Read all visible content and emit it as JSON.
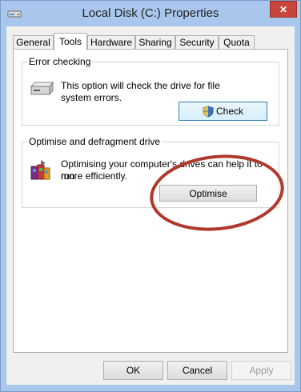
{
  "window": {
    "title": "Local Disk (C:) Properties",
    "close_label": "✕"
  },
  "tabs": [
    {
      "label": "General",
      "active": false
    },
    {
      "label": "Tools",
      "active": true
    },
    {
      "label": "Hardware",
      "active": false
    },
    {
      "label": "Sharing",
      "active": false
    },
    {
      "label": "Security",
      "active": false
    },
    {
      "label": "Quota",
      "active": false
    }
  ],
  "error_checking": {
    "heading": "Error checking",
    "description_line1": "This option will check the drive for file",
    "description_line2": "system errors.",
    "button_label": "Check",
    "icon": "drive-icon",
    "button_icon": "uac-shield-icon"
  },
  "optimise": {
    "heading": "Optimise and defragment drive",
    "description_line1": "Optimising your computer's drives can help it to run",
    "description_line2": "more efficiently.",
    "button_label": "Optimise",
    "icon": "defragment-icon"
  },
  "footer": {
    "ok_label": "OK",
    "cancel_label": "Cancel",
    "apply_label": "Apply"
  },
  "colors": {
    "title_bar": "#a9c7ec",
    "close_button": "#c7463b",
    "annotation_ellipse": "#b0392d"
  }
}
